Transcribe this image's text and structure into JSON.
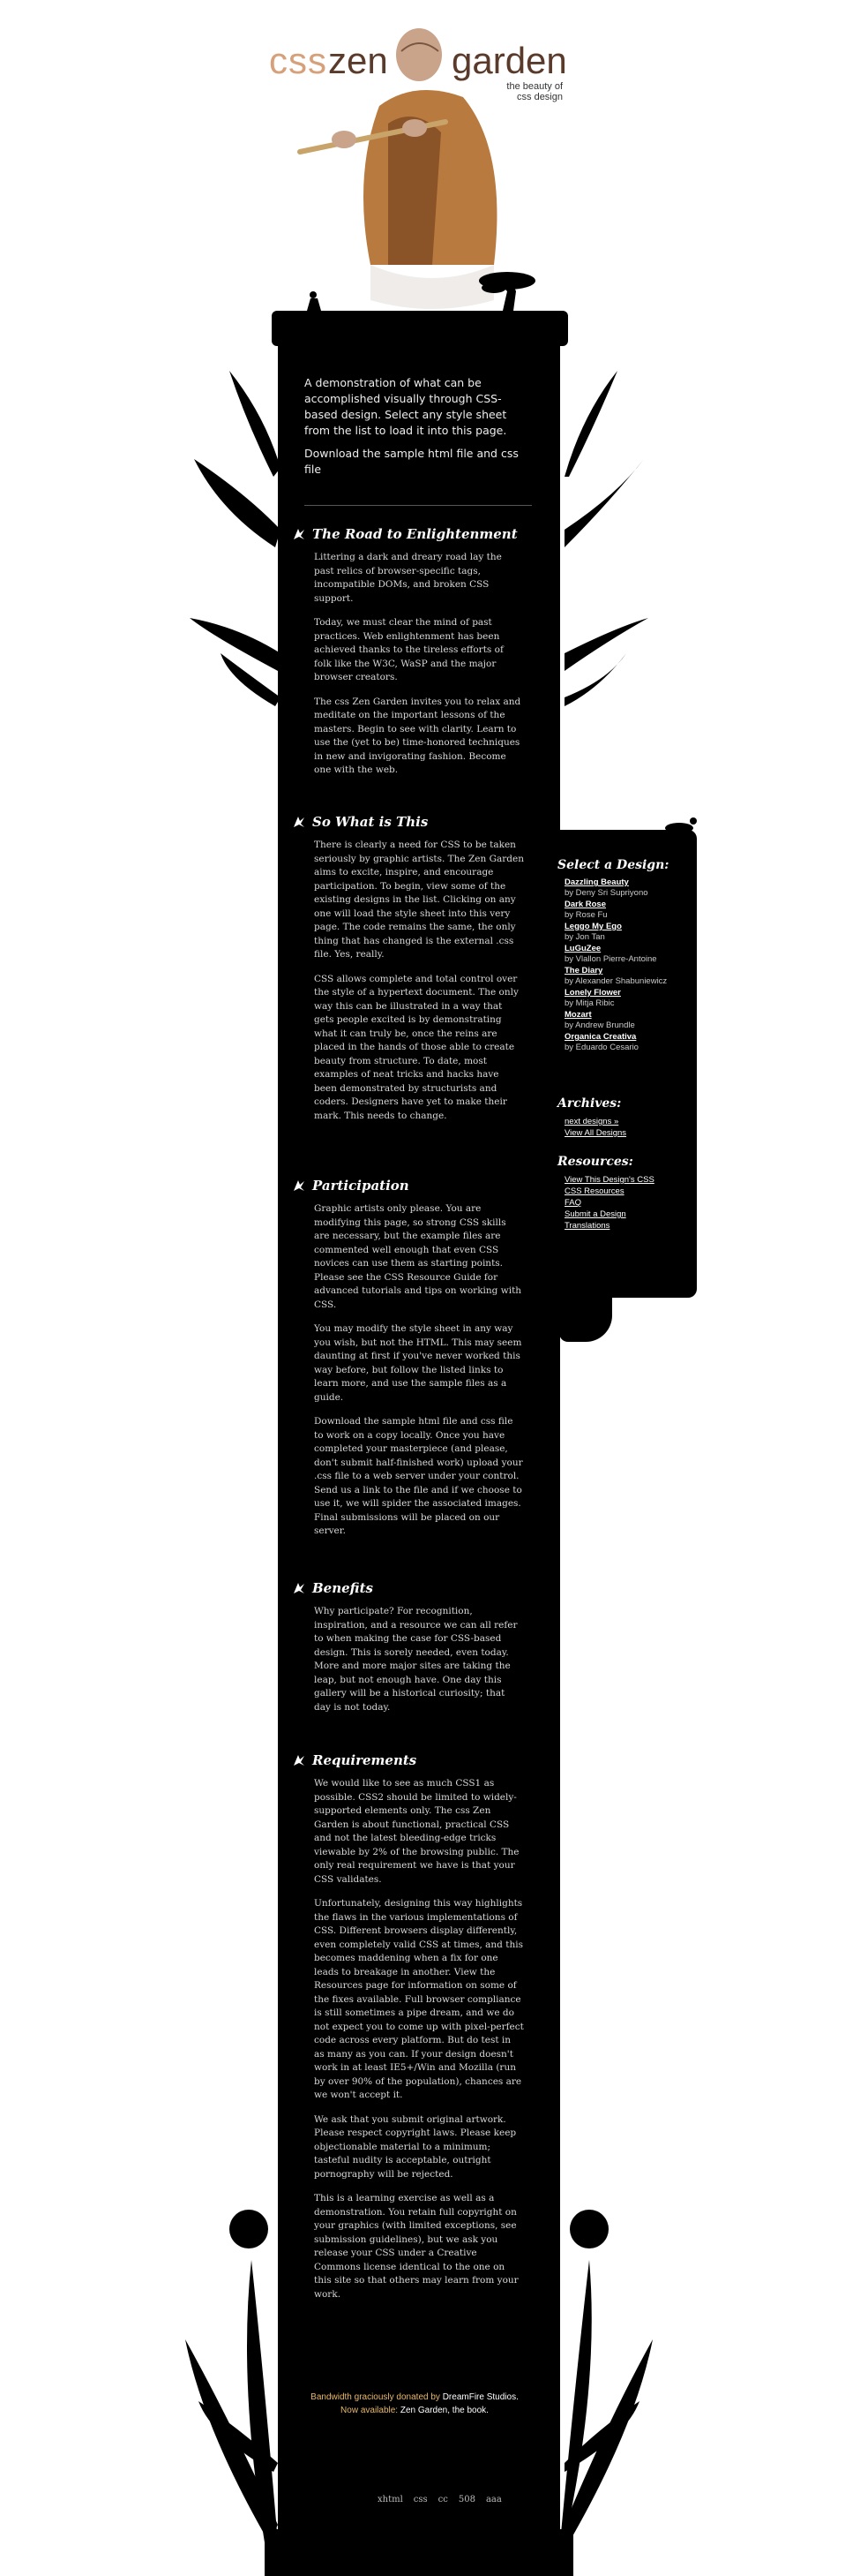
{
  "header": {
    "logo_css": "css",
    "logo_zen": "zen",
    "logo_garden": "garden",
    "tagline": "the beauty of css design"
  },
  "intro": {
    "summary": "A demonstration of what can be accomplished visually through CSS-based design. Select any style sheet from the list to load it into this page.",
    "download": "Download the sample html file and css file"
  },
  "sections": [
    {
      "title": "The Road to Enlightenment",
      "paragraphs": [
        "Littering a dark and dreary road lay the past relics of browser-specific tags, incompatible DOMs, and broken CSS support.",
        "Today, we must clear the mind of past practices. Web enlightenment has been achieved thanks to the tireless efforts of folk like the W3C, WaSP and the major browser creators.",
        "The css Zen Garden invites you to relax and meditate on the important lessons of the masters. Begin to see with clarity. Learn to use the (yet to be) time-honored techniques in new and invigorating fashion. Become one with the web."
      ]
    },
    {
      "title": "So What is This",
      "paragraphs": [
        "There is clearly a need for CSS to be taken seriously by graphic artists. The Zen Garden aims to excite, inspire, and encourage participation. To begin, view some of the existing designs in the list. Clicking on any one will load the style sheet into this very page. The code remains the same, the only thing that has changed is the external .css file. Yes, really.",
        "CSS allows complete and total control over the style of a hypertext document. The only way this can be illustrated in a way that gets people excited is by demonstrating what it can truly be, once the reins are placed in the hands of those able to create beauty from structure. To date, most examples of neat tricks and hacks have been demonstrated by structurists and coders. Designers have yet to make their mark. This needs to change."
      ]
    },
    {
      "title": "Participation",
      "paragraphs": [
        "Graphic artists only please. You are modifying this page, so strong CSS skills are necessary, but the example files are commented well enough that even CSS novices can use them as starting points. Please see the CSS Resource Guide for advanced tutorials and tips on working with CSS.",
        "You may modify the style sheet in any way you wish, but not the HTML. This may seem daunting at first if you've never worked this way before, but follow the listed links to learn more, and use the sample files as a guide.",
        "Download the sample html file and css file to work on a copy locally. Once you have completed your masterpiece (and please, don't submit half-finished work) upload your .css file to a web server under your control. Send us a link to the file and if we choose to use it, we will spider the associated images. Final submissions will be placed on our server."
      ]
    },
    {
      "title": "Benefits",
      "paragraphs": [
        "Why participate? For recognition, inspiration, and a resource we can all refer to when making the case for CSS-based design. This is sorely needed, even today. More and more major sites are taking the leap, but not enough have. One day this gallery will be a historical curiosity; that day is not today."
      ]
    },
    {
      "title": "Requirements",
      "paragraphs": [
        "We would like to see as much CSS1 as possible. CSS2 should be limited to widely-supported elements only. The css Zen Garden is about functional, practical CSS and not the latest bleeding-edge tricks viewable by 2% of the browsing public. The only real requirement we have is that your CSS validates.",
        "Unfortunately, designing this way highlights the flaws in the various implementations of CSS. Different browsers display differently, even completely valid CSS at times, and this becomes maddening when a fix for one leads to breakage in another. View the Resources page for information on some of the fixes available. Full browser compliance is still sometimes a pipe dream, and we do not expect you to come up with pixel-perfect code across every platform. But do test in as many as you can. If your design doesn't work in at least IE5+/Win and Mozilla (run by over 90% of the population), chances are we won't accept it.",
        "We ask that you submit original artwork. Please respect copyright laws. Please keep objectionable material to a minimum; tasteful nudity is acceptable, outright pornography will be rejected.",
        "This is a learning exercise as well as a demonstration. You retain full copyright on your graphics (with limited exceptions, see submission guidelines), but we ask you release your CSS under a Creative Commons license identical to the one on this site so that others may learn from your work."
      ]
    }
  ],
  "sidebar": {
    "select_title": "Select a Design:",
    "designs": [
      {
        "name": "Dazzling Beauty",
        "by": "by Deny Sri Supriyono"
      },
      {
        "name": "Dark Rose",
        "by": "by Rose Fu"
      },
      {
        "name": "Leggo My Ego",
        "by": "by Jon Tan"
      },
      {
        "name": "LuGuZee",
        "by": "by Vlallon Pierre-Antoine"
      },
      {
        "name": "The Diary",
        "by": "by Alexander Shabuniewicz"
      },
      {
        "name": "Lonely Flower",
        "by": "by Mitja Ribic"
      },
      {
        "name": "Mozart",
        "by": "by Andrew Brundle"
      },
      {
        "name": "Organica Creativa",
        "by": "by Eduardo Cesario"
      }
    ],
    "archives_title": "Archives:",
    "archives": [
      "next designs »",
      "View All Designs"
    ],
    "resources_title": "Resources:",
    "resources": [
      "View This Design's CSS",
      "CSS Resources",
      "FAQ",
      "Submit a Design",
      "Translations"
    ]
  },
  "footer": {
    "bandwidth_prefix": "Bandwidth graciously donated by",
    "bandwidth_host": "DreamFire Studios.",
    "now_available": "Now available:",
    "book": "Zen Garden, the book.",
    "validators": [
      "xhtml",
      "css",
      "cc",
      "508",
      "aaa"
    ]
  },
  "colors": {
    "background": "#ffffff",
    "column": "#000000",
    "logo_css": "#d6a07a",
    "logo_brown": "#5a3a2a",
    "footer_gold": "#e8b86a"
  }
}
